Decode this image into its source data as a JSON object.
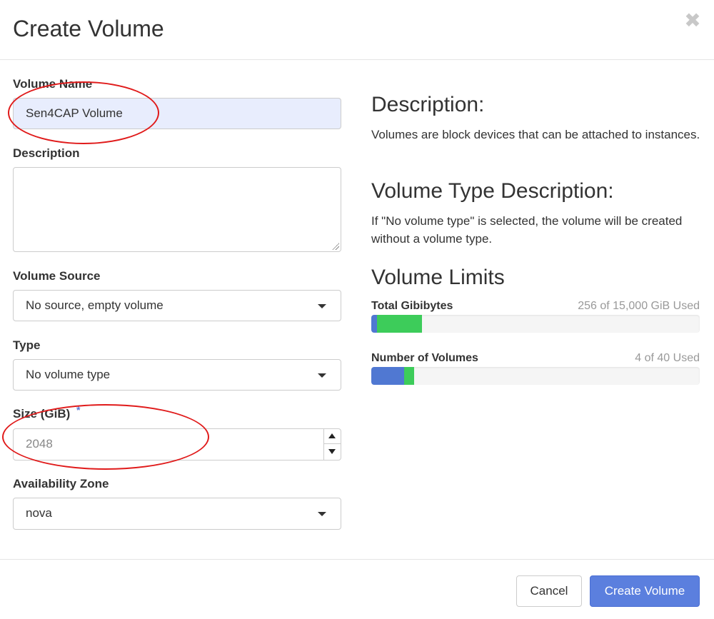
{
  "header": {
    "title": "Create Volume",
    "close_glyph": "✖",
    "close_icon": "close-icon"
  },
  "form": {
    "volume_name": {
      "label": "Volume Name",
      "value": "Sen4CAP Volume"
    },
    "description": {
      "label": "Description",
      "value": ""
    },
    "volume_source": {
      "label": "Volume Source",
      "selected": "No source, empty volume"
    },
    "type": {
      "label": "Type",
      "selected": "No volume type"
    },
    "size": {
      "label": "Size (GiB)",
      "required_marker": "*",
      "placeholder": "2048"
    },
    "availability_zone": {
      "label": "Availability Zone",
      "selected": "nova"
    }
  },
  "info": {
    "description_heading": "Description:",
    "description_text": "Volumes are block devices that can be attached to instances.",
    "type_heading": "Volume Type Description:",
    "type_text": "If \"No volume type\" is selected, the volume will be created without a volume type.",
    "limits_heading": "Volume Limits",
    "limits": [
      {
        "label": "Total Gibibytes",
        "used_text": "256 of 15,000 GiB Used",
        "current_fraction": 0.017,
        "added_fraction": 0.137
      },
      {
        "label": "Number of Volumes",
        "used_text": "4 of 40 Used",
        "current_fraction": 0.1,
        "added_fraction": 0.03
      }
    ]
  },
  "footer": {
    "cancel_label": "Cancel",
    "submit_label": "Create Volume"
  },
  "colors": {
    "primary": "#5b7fde",
    "bar_current": "#5078d2",
    "bar_added": "#3dcc5a",
    "annotation": "#e01a1a"
  }
}
